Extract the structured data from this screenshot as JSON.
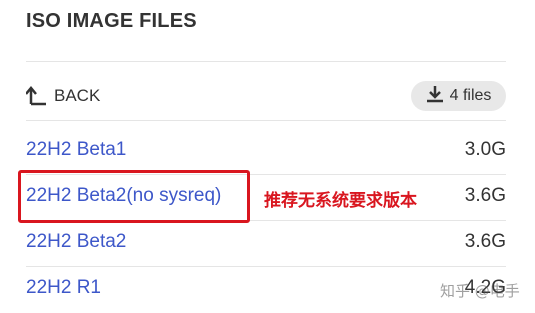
{
  "header": {
    "title": "ISO IMAGE FILES"
  },
  "toolbar": {
    "back_label": "BACK",
    "files_count": "4 files"
  },
  "files": [
    {
      "name": "22H2 Beta1",
      "size": "3.0G"
    },
    {
      "name": "22H2 Beta2(no sysreq)",
      "size": "3.6G"
    },
    {
      "name": "22H2 Beta2",
      "size": "3.6G"
    },
    {
      "name": "22H2 R1",
      "size": "4.2G"
    }
  ],
  "annotation": {
    "text": "推荐无系统要求版本",
    "color": "#d9161f"
  },
  "watermark": "知乎 @电手",
  "colors": {
    "link": "#3d57c9",
    "badge_bg": "#e8e8e8",
    "divider": "#e5e5e5"
  }
}
